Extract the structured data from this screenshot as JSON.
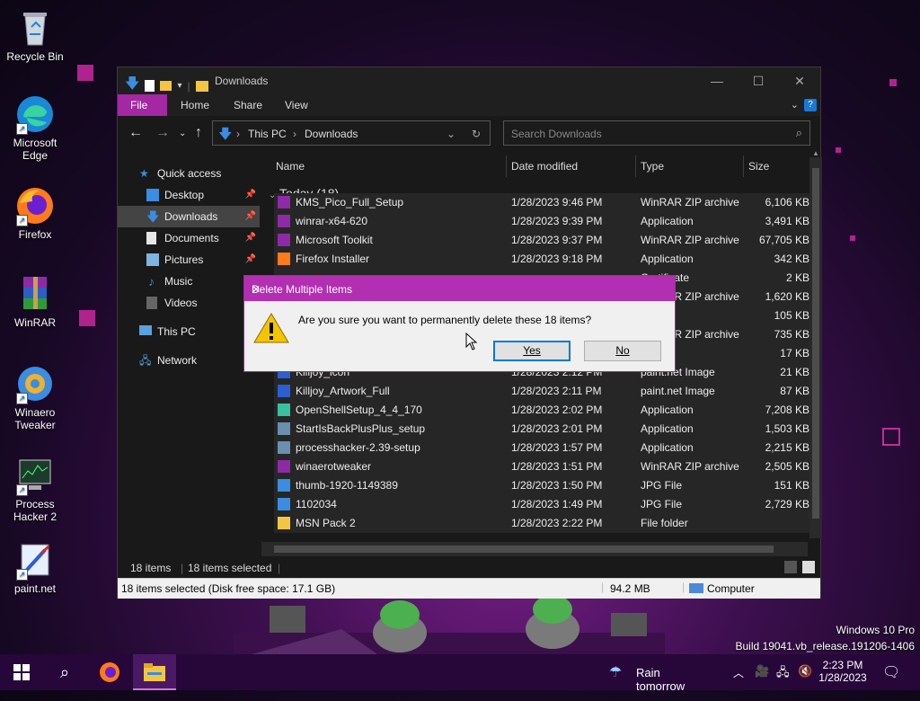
{
  "desktop": {
    "icons": [
      {
        "label": "Recycle Bin",
        "icon": "recycle-bin-icon"
      },
      {
        "label": "Microsoft Edge",
        "icon": "edge-icon"
      },
      {
        "label": "Firefox",
        "icon": "firefox-icon"
      },
      {
        "label": "WinRAR",
        "icon": "winrar-icon"
      },
      {
        "label": "Winaero Tweaker",
        "icon": "winaero-tweaker-icon"
      },
      {
        "label": "Process Hacker 2",
        "icon": "process-hacker-icon"
      },
      {
        "label": "paint.net",
        "icon": "paint-net-icon"
      }
    ],
    "watermark": {
      "line1": "Windows 10 Pro",
      "line2": "Build 19041.vb_release.191206-1406"
    }
  },
  "window": {
    "title": "Downloads",
    "ribbon_tabs": [
      "File",
      "Home",
      "Share",
      "View"
    ],
    "address": {
      "crumbs": [
        "This PC",
        "Downloads"
      ],
      "search_placeholder": "Search Downloads"
    },
    "nav": {
      "quick_access": "Quick access",
      "items": [
        {
          "label": "Desktop",
          "pinned": true,
          "icon": "desktop-folder-icon"
        },
        {
          "label": "Downloads",
          "pinned": true,
          "icon": "downloads-folder-icon",
          "selected": true
        },
        {
          "label": "Documents",
          "pinned": true,
          "icon": "documents-folder-icon"
        },
        {
          "label": "Pictures",
          "pinned": true,
          "icon": "pictures-folder-icon"
        },
        {
          "label": "Music",
          "pinned": false,
          "icon": "music-folder-icon"
        },
        {
          "label": "Videos",
          "pinned": false,
          "icon": "videos-folder-icon"
        }
      ],
      "this_pc": "This PC",
      "network": "Network"
    },
    "columns": [
      "Name",
      "Date modified",
      "Type",
      "Size"
    ],
    "group": "Today (18)",
    "files": [
      {
        "name": "KMS_Pico_Full_Setup",
        "date": "1/28/2023 9:46 PM",
        "type": "WinRAR ZIP archive",
        "size": "6,106 KB",
        "icon": "winrar"
      },
      {
        "name": "winrar-x64-620",
        "date": "1/28/2023 9:39 PM",
        "type": "Application",
        "size": "3,491 KB",
        "icon": "winrar"
      },
      {
        "name": "Microsoft Toolkit",
        "date": "1/28/2023 9:37 PM",
        "type": "WinRAR ZIP archive",
        "size": "67,705 KB",
        "icon": "winrar"
      },
      {
        "name": "Firefox Installer",
        "date": "1/28/2023 9:18 PM",
        "type": "Application",
        "size": "342 KB",
        "icon": "firefox"
      },
      {
        "name": "",
        "date": "",
        "type": "Certificate",
        "size": "2 KB",
        "icon": ""
      },
      {
        "name": "",
        "date": "",
        "type": "WinRAR ZIP archive",
        "size": "1,620 KB",
        "icon": ""
      },
      {
        "name": "",
        "date": "",
        "type": "e",
        "size": "105 KB",
        "icon": ""
      },
      {
        "name": "",
        "date": "",
        "type": "WinRAR ZIP archive",
        "size": "735 KB",
        "icon": ""
      },
      {
        "name": "",
        "date": "",
        "type": "",
        "size": "17 KB",
        "icon": ""
      },
      {
        "name": "Killjoy_icon",
        "date": "1/28/2023 2:12 PM",
        "type": "paint.net Image",
        "size": "21 KB",
        "icon": "paint"
      },
      {
        "name": "Killjoy_Artwork_Full",
        "date": "1/28/2023 2:11 PM",
        "type": "paint.net Image",
        "size": "87 KB",
        "icon": "paint"
      },
      {
        "name": "OpenShellSetup_4_4_170",
        "date": "1/28/2023 2:02 PM",
        "type": "Application",
        "size": "7,208 KB",
        "icon": "shell"
      },
      {
        "name": "StartIsBackPlusPlus_setup",
        "date": "1/28/2023 2:01 PM",
        "type": "Application",
        "size": "1,503 KB",
        "icon": "app"
      },
      {
        "name": "processhacker-2.39-setup",
        "date": "1/28/2023 1:57 PM",
        "type": "Application",
        "size": "2,215 KB",
        "icon": "app"
      },
      {
        "name": "winaerotweaker",
        "date": "1/28/2023 1:51 PM",
        "type": "WinRAR ZIP archive",
        "size": "2,505 KB",
        "icon": "winrar"
      },
      {
        "name": "thumb-1920-1149389",
        "date": "1/28/2023 1:50 PM",
        "type": "JPG File",
        "size": "151 KB",
        "icon": "jpg"
      },
      {
        "name": "1102034",
        "date": "1/28/2023 1:49 PM",
        "type": "JPG File",
        "size": "2,729 KB",
        "icon": "jpg"
      },
      {
        "name": "MSN Pack 2",
        "date": "1/28/2023 2:22 PM",
        "type": "File folder",
        "size": "",
        "icon": "folder"
      }
    ],
    "status": {
      "count": "18 items",
      "selected": "18 items selected"
    },
    "details": {
      "left": "18 items selected (Disk free space: 17.1 GB)",
      "size": "94.2 MB",
      "location": "Computer"
    }
  },
  "dialog": {
    "title": "Delete Multiple Items",
    "message": "Are you sure you want to permanently delete these 18 items?",
    "yes": "Yes",
    "no": "No"
  },
  "taskbar": {
    "weather": "Rain tomorrow",
    "time": "2:23 PM",
    "date": "1/28/2023"
  },
  "colors": {
    "accent": "#b32fb1",
    "taskbar": "#27073a"
  }
}
